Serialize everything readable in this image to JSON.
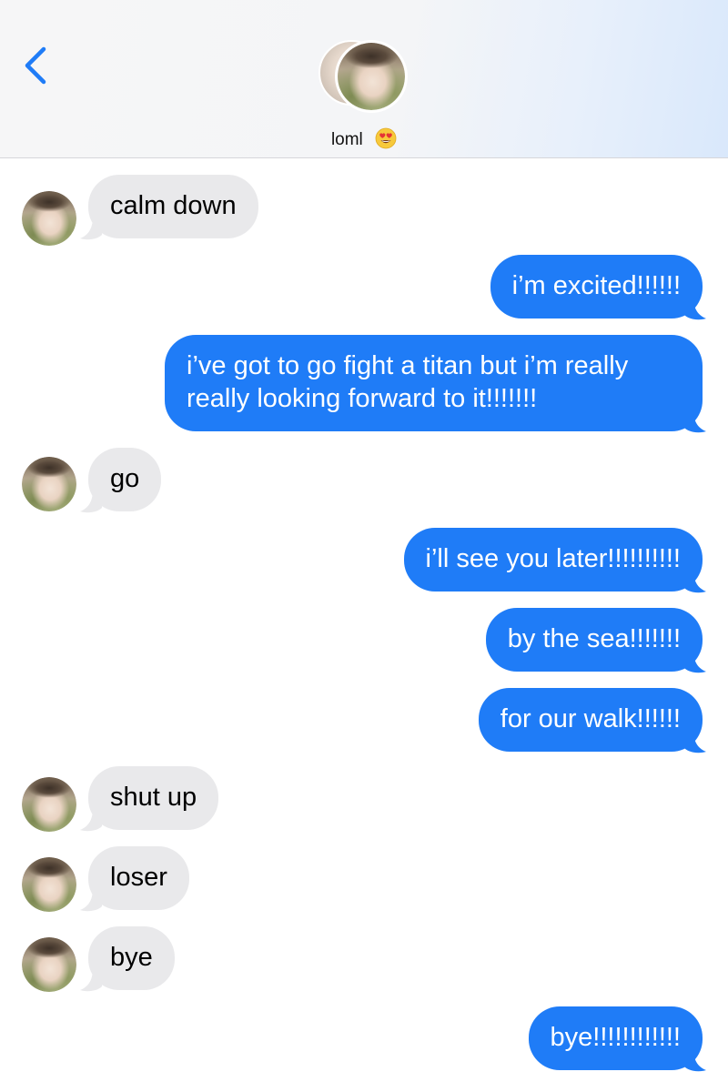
{
  "header": {
    "back_icon": "chevron-left-icon",
    "contact_name": "loml",
    "contact_emoji": "heart-eyes-emoji",
    "accent_color": "#1f7cf7"
  },
  "messages": [
    {
      "direction": "in",
      "text": "calm down",
      "has_avatar": true
    },
    {
      "direction": "out",
      "text": "i’m excited!!!!!!"
    },
    {
      "direction": "out",
      "lines": [
        "i’ve got to go fight a titan but i’m really",
        "really looking forward to it!!!!!!!"
      ]
    },
    {
      "direction": "in",
      "text": "go",
      "has_avatar": true
    },
    {
      "direction": "out",
      "text": "i’ll see you later!!!!!!!!!!"
    },
    {
      "direction": "out",
      "text": "by the sea!!!!!!!"
    },
    {
      "direction": "out",
      "text": "for our walk!!!!!!"
    },
    {
      "direction": "in",
      "text": "shut up",
      "has_avatar": true
    },
    {
      "direction": "in",
      "text": "loser",
      "has_avatar": true
    },
    {
      "direction": "in",
      "text": "bye",
      "has_avatar": true
    },
    {
      "direction": "out",
      "text": "bye!!!!!!!!!!!!"
    }
  ],
  "colors": {
    "incoming_bubble": "#e9e9eb",
    "outgoing_bubble": "#1f7cf7"
  }
}
